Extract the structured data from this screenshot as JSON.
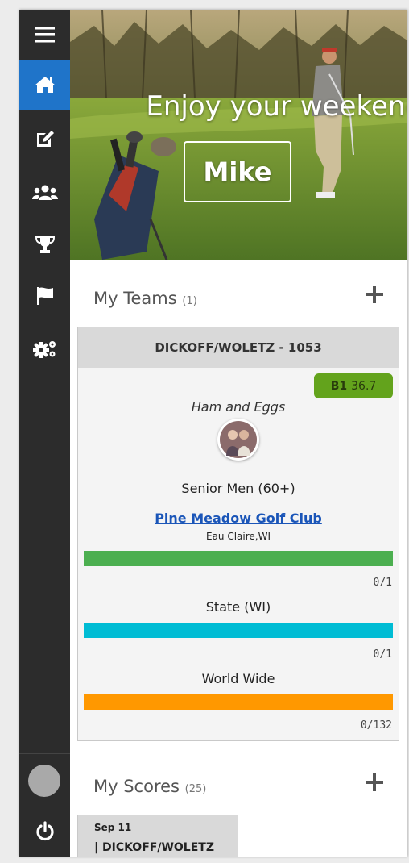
{
  "sidebar": {
    "items": [
      {
        "icon": "hamburger-menu-icon"
      },
      {
        "icon": "home-icon",
        "active": true
      },
      {
        "icon": "edit-icon"
      },
      {
        "icon": "users-icon"
      },
      {
        "icon": "trophy-icon"
      },
      {
        "icon": "flag-icon"
      },
      {
        "icon": "cogs-icon"
      }
    ],
    "active_color": "#1f74c9",
    "power_icon": "power-icon"
  },
  "hero": {
    "greeting": "Enjoy your weekend",
    "name": "Mike"
  },
  "teams_section": {
    "title": "My Teams",
    "count": "(1)",
    "add_icon": "plus-icon"
  },
  "team": {
    "header": "DICKOFF/WOLETZ - 1053",
    "badge_label": "B1",
    "badge_value": "36.7",
    "badge_color": "#63a31c",
    "name": "Ham and Eggs",
    "division": "Senior Men (60+)",
    "club": "Pine Meadow Golf Club",
    "location": "Eau Claire,WI",
    "rankings": [
      {
        "label": "",
        "count": "0/1",
        "color": "#4caf50"
      },
      {
        "label": "State (WI)",
        "count": "0/1",
        "color": "#00bcd4"
      },
      {
        "label": "World Wide",
        "count": "0/132",
        "color": "#ff9800"
      }
    ]
  },
  "scores_section": {
    "title": "My Scores",
    "count": "(25)",
    "add_icon": "plus-icon"
  },
  "score": {
    "date": "Sep 11",
    "team": "| DICKOFF/WOLETZ"
  }
}
